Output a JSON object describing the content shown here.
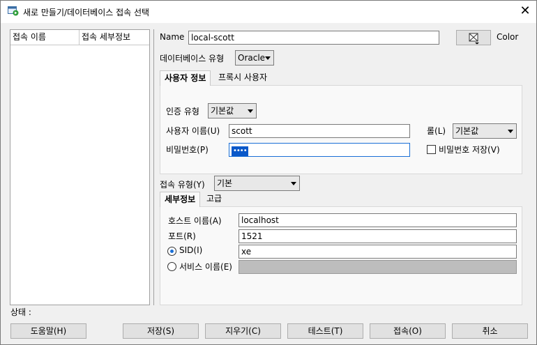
{
  "window": {
    "title": "새로 만들기/데이터베이스 접속 선택",
    "close_glyph": "✕"
  },
  "connection_list": {
    "columns": [
      "접속 이름",
      "접속 세부정보"
    ]
  },
  "form": {
    "name_label": "Name",
    "name_value": "local-scott",
    "color_label": "Color",
    "db_type_label": "데이터베이스 유형",
    "db_type_value": "Oracle",
    "tabs": [
      "사용자 정보",
      "프록시 사용자"
    ],
    "auth_type_label": "인증 유형",
    "auth_type_value": "기본값",
    "username_label": "사용자 이름(U)",
    "username_value": "scott",
    "role_label": "롤(L)",
    "role_value": "기본값",
    "password_label": "비밀번호(P)",
    "password_mask": "••••",
    "save_password_label": "비밀번호 저장(V)",
    "conn_type_label": "접속 유형(Y)",
    "conn_type_value": "기본",
    "sub_tabs": [
      "세부정보",
      "고급"
    ],
    "host_label": "호스트 이름(A)",
    "host_value": "localhost",
    "port_label": "포트(R)",
    "port_value": "1521",
    "sid_label": "SID(I)",
    "sid_value": "xe",
    "service_label": "서비스 이름(E)",
    "service_value": ""
  },
  "status_label": "상태 :",
  "buttons": {
    "help": "도움말(H)",
    "save": "저장(S)",
    "clear": "지우기(C)",
    "test": "테스트(T)",
    "connect": "접속(O)",
    "cancel": "취소"
  },
  "colors": {
    "selection": "#0a58c9",
    "radio_dot": "#1a6fd6"
  }
}
